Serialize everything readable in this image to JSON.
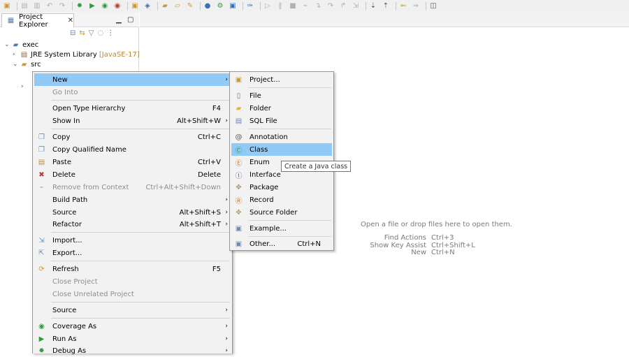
{
  "toolbar": {
    "icons": [
      "new-file-icon",
      "save-icon",
      "save-all-icon",
      "undo-icon",
      "redo-icon",
      "debug-icon",
      "run-icon",
      "coverage-icon",
      "external-tools-icon",
      "new-java-project-icon",
      "new-package-icon",
      "new-class-icon",
      "open-type-icon",
      "search-icon",
      "globe-icon",
      "perspective-icon",
      "console-icon",
      "pin-icon",
      "resume-icon",
      "suspend-icon",
      "terminate-icon",
      "disconnect-icon",
      "step-into-icon",
      "step-over-icon",
      "step-return-icon",
      "drop-frame-icon",
      "annotation-next-icon",
      "annotation-prev-icon",
      "back-icon",
      "forward-icon",
      "maximize-icon"
    ]
  },
  "project_explorer": {
    "tab_label": "Project Explorer",
    "tree": [
      {
        "label": "exec",
        "decoration": "",
        "expanded": true,
        "level": 0
      },
      {
        "label": "JRE System Library",
        "decoration": "[JavaSE-17]",
        "expanded": false,
        "level": 1
      },
      {
        "label": "src",
        "decoration": "",
        "expanded": true,
        "level": 1
      }
    ]
  },
  "editor_area": {
    "hint": "Open a file or drop files here to open them.",
    "actions": [
      {
        "name": "Find Actions",
        "key": "Ctrl+3"
      },
      {
        "name": "Show Key Assist",
        "key": "Ctrl+Shift+L"
      },
      {
        "name": "New",
        "key": "Ctrl+N"
      }
    ]
  },
  "context_menu": {
    "items": [
      {
        "label": "New",
        "key": "",
        "arrow": true,
        "highlighted": true
      },
      {
        "label": "Go Into",
        "key": "",
        "disabled": true
      },
      {
        "label": "Open Type Hierarchy",
        "key": "F4"
      },
      {
        "label": "Show In",
        "key": "Alt+Shift+W",
        "arrow": true
      },
      {
        "label": "Copy",
        "key": "Ctrl+C"
      },
      {
        "label": "Copy Qualified Name",
        "key": ""
      },
      {
        "label": "Paste",
        "key": "Ctrl+V"
      },
      {
        "label": "Delete",
        "key": "Delete"
      },
      {
        "label": "Remove from Context",
        "key": "Ctrl+Alt+Shift+Down",
        "disabled": true
      },
      {
        "label": "Build Path",
        "key": "",
        "arrow": true
      },
      {
        "label": "Source",
        "key": "Alt+Shift+S",
        "arrow": true
      },
      {
        "label": "Refactor",
        "key": "Alt+Shift+T",
        "arrow": true
      },
      {
        "label": "Import...",
        "key": ""
      },
      {
        "label": "Export...",
        "key": ""
      },
      {
        "label": "Refresh",
        "key": "F5"
      },
      {
        "label": "Close Project",
        "key": "",
        "disabled": true
      },
      {
        "label": "Close Unrelated Project",
        "key": "",
        "disabled": true
      },
      {
        "label": "Source",
        "key": "",
        "arrow": true
      },
      {
        "label": "Coverage As",
        "key": "",
        "arrow": true
      },
      {
        "label": "Run As",
        "key": "",
        "arrow": true
      },
      {
        "label": "Debug As",
        "key": "",
        "arrow": true
      }
    ]
  },
  "submenu": {
    "items": [
      {
        "label": "Project...",
        "key": ""
      },
      {
        "label": "File",
        "key": ""
      },
      {
        "label": "Folder",
        "key": ""
      },
      {
        "label": "SQL File",
        "key": ""
      },
      {
        "label": "Annotation",
        "key": ""
      },
      {
        "label": "Class",
        "key": "",
        "highlighted": true
      },
      {
        "label": "Enum",
        "key": ""
      },
      {
        "label": "Interface",
        "key": ""
      },
      {
        "label": "Package",
        "key": ""
      },
      {
        "label": "Record",
        "key": ""
      },
      {
        "label": "Source Folder",
        "key": ""
      },
      {
        "label": "Example...",
        "key": ""
      },
      {
        "label": "Other...",
        "key": "Ctrl+N"
      }
    ]
  },
  "tooltip": {
    "text": "Create a Java class"
  },
  "colors": {
    "highlight": "#91c9f7",
    "menu_bg": "#f2f2f2",
    "disabled_text": "#8d8d8d",
    "hint_text": "#7a7a7a"
  }
}
